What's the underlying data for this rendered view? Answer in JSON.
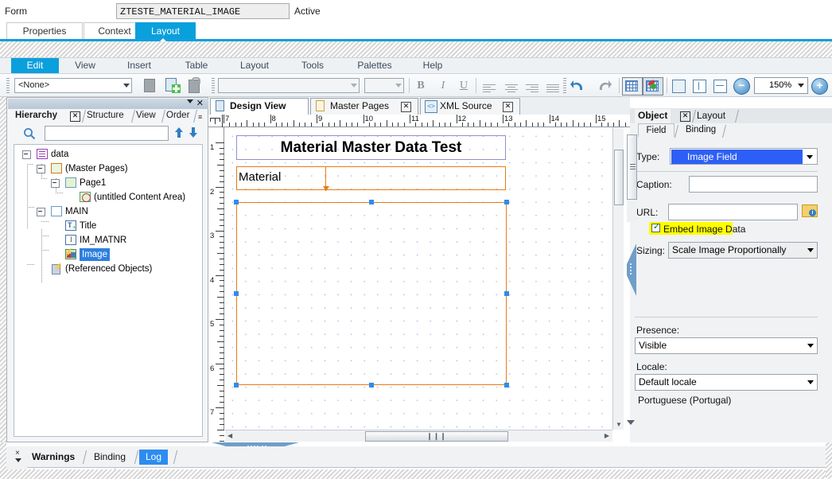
{
  "sap": {
    "form_label": "Form",
    "form_name": "ZTESTE_MATERIAL_IMAGE",
    "status": "Active",
    "tabs": [
      {
        "label": "Properties",
        "selected": false
      },
      {
        "label": "Context",
        "selected": false
      },
      {
        "label": "Layout",
        "selected": true
      }
    ]
  },
  "menu": {
    "items": [
      {
        "label": "Edit",
        "active": true
      },
      {
        "label": "View",
        "active": false
      },
      {
        "label": "Insert",
        "active": false
      },
      {
        "label": "Table",
        "active": false
      },
      {
        "label": "Layout",
        "active": false
      },
      {
        "label": "Tools",
        "active": false
      },
      {
        "label": "Palettes",
        "active": false
      },
      {
        "label": "Help",
        "active": false
      }
    ]
  },
  "toolbar": {
    "style_combo_value": "<None>",
    "font_combo_value": "",
    "size_combo_value": "",
    "bold_label": "B",
    "italic_label": "I",
    "underline_label": "U",
    "zoom_value": "150%",
    "zoom_out_sign": "−",
    "zoom_in_sign": "+",
    "icons": [
      "new-document-icon",
      "new-page-icon",
      "lock-document-icon",
      "undo-icon",
      "redo-icon",
      "show-grid-icon",
      "snap-to-grid-icon",
      "fit-page-icon",
      "fit-height-icon",
      "fit-width-icon"
    ]
  },
  "hierarchy_panel": {
    "tabs": [
      {
        "label": "Hierarchy",
        "selected": true,
        "closable": true
      },
      {
        "label": "Structure",
        "selected": false,
        "closable": false
      },
      {
        "label": "View",
        "selected": false,
        "closable": false
      },
      {
        "label": "Order",
        "selected": false,
        "closable": false
      }
    ],
    "search_value": "",
    "tree": [
      {
        "label": "data",
        "indent": 0,
        "icon": "data-node-icon",
        "expander": true,
        "selected": false
      },
      {
        "label": "(Master Pages)",
        "indent": 1,
        "icon": "master-pages-icon",
        "expander": true,
        "selected": false
      },
      {
        "label": "Page1",
        "indent": 2,
        "icon": "page-icon",
        "expander": true,
        "selected": false
      },
      {
        "label": "(untitled Content Area)",
        "indent": 3,
        "icon": "content-area-icon",
        "expander": false,
        "selected": false
      },
      {
        "label": "MAIN",
        "indent": 1,
        "icon": "subform-icon",
        "expander": true,
        "selected": false
      },
      {
        "label": "Title",
        "indent": 2,
        "icon": "text-field-icon",
        "expander": false,
        "selected": false
      },
      {
        "label": "IM_MATNR",
        "indent": 2,
        "icon": "text-input-icon",
        "expander": false,
        "selected": false
      },
      {
        "label": "Image",
        "indent": 2,
        "icon": "image-field-icon",
        "expander": false,
        "selected": true
      },
      {
        "label": "(Referenced Objects)",
        "indent": 1,
        "icon": "referenced-objects-icon",
        "expander": false,
        "selected": false
      }
    ]
  },
  "design": {
    "tabs": [
      {
        "label": "Design View",
        "selected": true,
        "closable": false,
        "icon": "page-icon"
      },
      {
        "label": "Master Pages",
        "selected": false,
        "closable": true,
        "icon": "page-icon"
      },
      {
        "label": "XML Source",
        "selected": false,
        "closable": true,
        "icon": "xml-icon"
      }
    ],
    "ruler_h": [
      "7",
      "8",
      "9",
      "10",
      "11",
      "12",
      "13",
      "14",
      "15"
    ],
    "ruler_v": [
      "1",
      "2",
      "3",
      "4",
      "5",
      "6",
      "7"
    ],
    "title_text": "Material Master Data Test",
    "material_caption": "Material",
    "material_value": "",
    "scroll_thumb_grip": "❙❙❙",
    "left_arrow": "◀",
    "right_arrow": "▶",
    "down_arrow": "▼"
  },
  "object_panel": {
    "tabs": [
      {
        "label": "Object",
        "selected": true,
        "closable": true
      },
      {
        "label": "Layout",
        "selected": false,
        "closable": false
      }
    ],
    "subtabs": [
      {
        "label": "Field",
        "selected": true
      },
      {
        "label": "Binding",
        "selected": false
      }
    ],
    "type_label": "Type:",
    "type_value": "Image Field",
    "caption_label": "Caption:",
    "caption_value": "",
    "url_label": "URL:",
    "url_value": "",
    "browse_icon": "folder-browse-icon",
    "embed_label": "Embed Image Data",
    "embed_checked": true,
    "embed_highlight_color": "#ffff00",
    "sizing_label": "Sizing:",
    "sizing_value": "Scale Image Proportionally",
    "presence_label": "Presence:",
    "presence_value": "Visible",
    "locale_label": "Locale:",
    "locale_value": "Default locale",
    "locale_detail": "Portuguese (Portugal)"
  },
  "bottom_panel": {
    "tabs": [
      {
        "label": "Warnings",
        "selected": true,
        "style": "plain"
      },
      {
        "label": "Binding",
        "selected": false,
        "style": "plain"
      },
      {
        "label": "Log",
        "selected": false,
        "style": "highlight"
      }
    ],
    "close_glyph": "×"
  },
  "colors": {
    "accent_blue": "#0aa0dc",
    "selection_blue": "#2d7fe0",
    "field_orange": "#e87b14",
    "title_purple": "#8f8fd0",
    "highlight_yellow": "#ffff00",
    "type_value_blue": "#2d5ff7"
  }
}
